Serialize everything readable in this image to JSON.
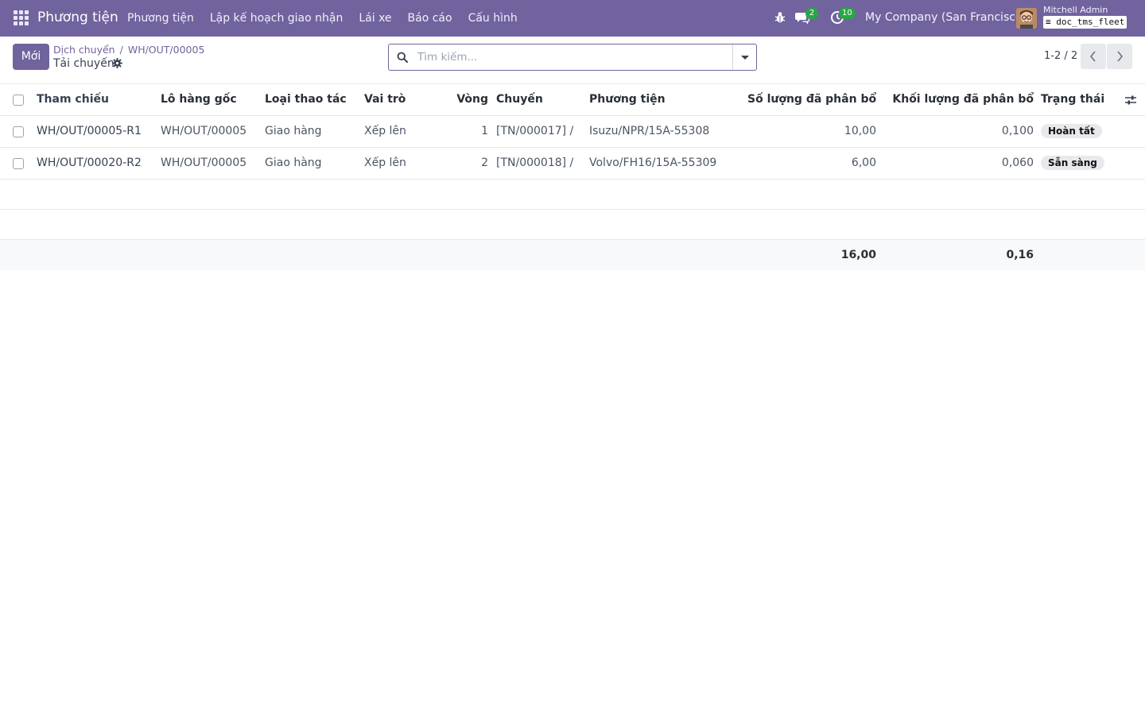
{
  "navbar": {
    "app_name": "Phương tiện",
    "menu": [
      "Phương tiện",
      "Lập kế hoạch giao nhận",
      "Lái xe",
      "Báo cáo",
      "Cấu hình"
    ],
    "messages_count": "2",
    "activities_count": "10",
    "company": "My Company (San Francisco)",
    "user_name": "Mitchell Admin",
    "database": "doc_tms_fleet",
    "icons": [
      "apps-icon",
      "bug-icon",
      "chat-icon",
      "clock-icon",
      "avatar"
    ]
  },
  "control_panel": {
    "new_button": "Mới",
    "breadcrumb": [
      "Dịch chuyển",
      "WH/OUT/00005"
    ],
    "title": "Tải chuyến",
    "search_placeholder": "Tìm kiếm...",
    "pager": "1-2 / 2"
  },
  "table": {
    "columns": [
      "Tham chiếu",
      "Lô hàng gốc",
      "Loại thao tác",
      "Vai trò",
      "Vòng",
      "Chuyến",
      "Phương tiện",
      "Số lượng đã phân bổ",
      "Khối lượng đã phân bổ",
      "Trạng thái"
    ],
    "rows": [
      {
        "reference": "WH/OUT/00005-R1",
        "origin": "WH/OUT/00005",
        "operation_type": "Giao hàng",
        "role": "Xếp lên",
        "round": "1",
        "trip": "[TN/000017] /",
        "vehicle": "Isuzu/NPR/15A-55308",
        "quantity": "10,00",
        "weight": "0,100",
        "state": "Hoàn tất"
      },
      {
        "reference": "WH/OUT/00020-R2",
        "origin": "WH/OUT/00005",
        "operation_type": "Giao hàng",
        "role": "Xếp lên",
        "round": "2",
        "trip": "[TN/000018] /",
        "vehicle": "Volvo/FH16/15A-55309",
        "quantity": "6,00",
        "weight": "0,060",
        "state": "Sẵn sàng"
      }
    ],
    "totals": {
      "quantity": "16,00",
      "weight": "0,16"
    }
  },
  "colors": {
    "brand": "#71639e",
    "badge": "#28a745",
    "tag_bg": "#e7e9ed"
  }
}
